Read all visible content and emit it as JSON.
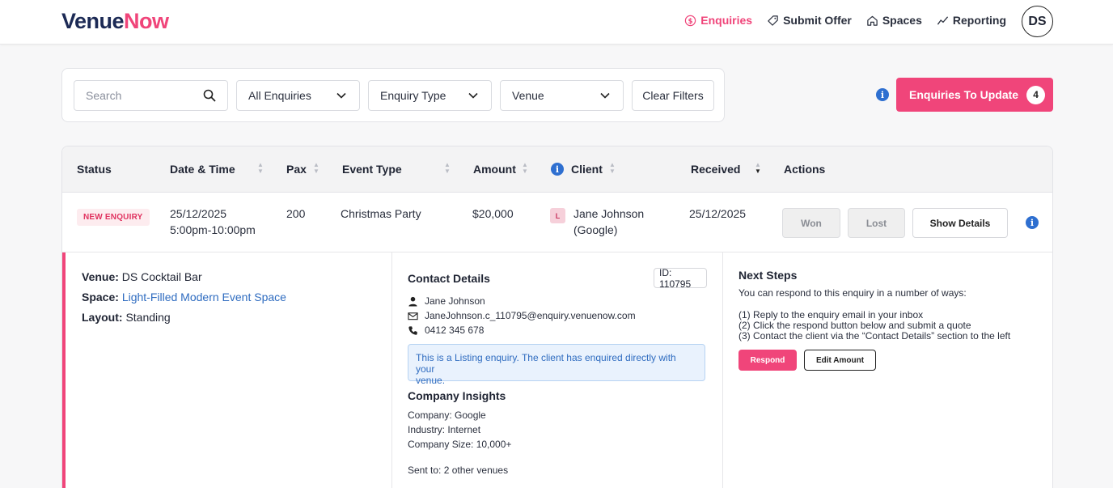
{
  "brand": {
    "part1": "Venue",
    "part2": "Now"
  },
  "nav": [
    {
      "label": "Enquiries",
      "icon": "dollar-circle-icon",
      "active": true
    },
    {
      "label": "Submit Offer",
      "icon": "tag-icon"
    },
    {
      "label": "Spaces",
      "icon": "home-icon"
    },
    {
      "label": "Reporting",
      "icon": "trend-icon"
    }
  ],
  "user": {
    "initials": "DS"
  },
  "filters": {
    "search_placeholder": "Search",
    "all_enquiries": "All Enquiries",
    "enquiry_type": "Enquiry Type",
    "venue": "Venue",
    "clear": "Clear Filters"
  },
  "update_button": {
    "label": "Enquiries To Update",
    "count": "4"
  },
  "table": {
    "headers": {
      "status": "Status",
      "date_time": "Date & Time",
      "pax": "Pax",
      "event_type": "Event Type",
      "amount": "Amount",
      "client": "Client",
      "received": "Received",
      "actions": "Actions"
    },
    "row": {
      "status": "NEW ENQUIRY",
      "date": "25/12/2025",
      "time": "5:00pm-10:00pm",
      "pax": "200",
      "event_type": "Christmas Party",
      "amount": "$20,000",
      "client_initial": "L",
      "client_name": "Jane Johnson",
      "client_company": "(Google)",
      "received": "25/12/2025",
      "won": "Won",
      "lost": "Lost",
      "show_details": "Show Details"
    }
  },
  "details": {
    "venue_label": "Venue:",
    "venue": "DS Cocktail Bar",
    "space_label": "Space:",
    "space": "Light-Filled Modern Event Space",
    "layout_label": "Layout:",
    "layout": "Standing",
    "contact_title": "Contact Details",
    "id": "ID: 110795",
    "contact_name": "Jane Johnson",
    "contact_email": "JaneJohnson.c_110795@enquiry.venuenow.com",
    "contact_phone": "0412 345 678",
    "notice_line1": "This is a Listing enquiry. The client has enquired directly with your",
    "notice_line2": "venue.",
    "insights_title": "Company Insights",
    "company": "Company: Google",
    "industry": "Industry: Internet",
    "company_size": "Company Size: 10,000+",
    "sent_to": "Sent to: 2 other venues",
    "next_steps_title": "Next Steps",
    "next_steps_intro": "You can respond to this enquiry in a number of ways:",
    "step1": "(1) Reply to the enquiry email in your inbox",
    "step2": "(2) Click the respond button below and submit a quote",
    "step3": "(3) Contact the client via the “Contact Details” section to the left",
    "respond": "Respond",
    "edit_amount": "Edit Amount"
  },
  "colors": {
    "brand_pink": "#f0457a",
    "brand_navy": "#1c2a55",
    "info_blue": "#2e6fd0"
  }
}
